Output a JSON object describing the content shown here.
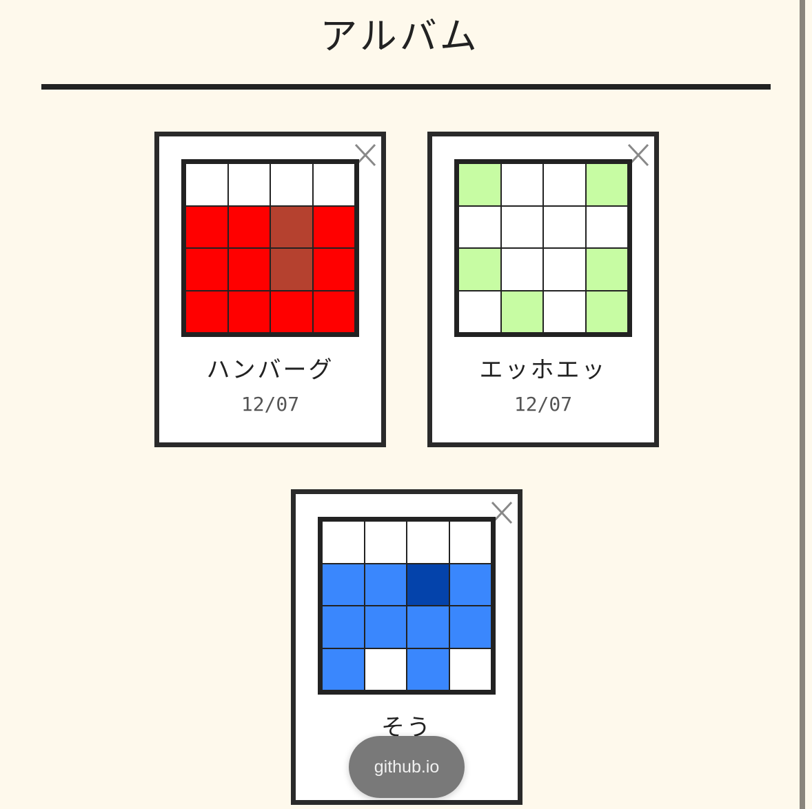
{
  "page": {
    "title": "アルバム"
  },
  "colors": {
    "background": "#fef9ec",
    "card_border": "#2a2a2a",
    "grid_border": "#222222"
  },
  "album": {
    "items": [
      {
        "name": "ハンバーグ",
        "date": "12/07",
        "close_icon": "close-icon",
        "pixels": [
          "#ffffff",
          "#ffffff",
          "#ffffff",
          "#ffffff",
          "#ff0000",
          "#ff0000",
          "#b5412f",
          "#ff0000",
          "#ff0000",
          "#ff0000",
          "#b5412f",
          "#ff0000",
          "#ff0000",
          "#ff0000",
          "#ff0000",
          "#ff0000"
        ]
      },
      {
        "name": "エッホエッ",
        "date": "12/07",
        "close_icon": "close-icon",
        "pixels": [
          "#c7fca3",
          "#ffffff",
          "#ffffff",
          "#c7fca3",
          "#ffffff",
          "#ffffff",
          "#ffffff",
          "#ffffff",
          "#c7fca3",
          "#ffffff",
          "#ffffff",
          "#c7fca3",
          "#ffffff",
          "#c7fca3",
          "#ffffff",
          "#c7fca3"
        ]
      },
      {
        "name": "そう",
        "date": "",
        "close_icon": "close-icon",
        "pixels": [
          "#ffffff",
          "#ffffff",
          "#ffffff",
          "#ffffff",
          "#3a87fd",
          "#3a87fd",
          "#0443ab",
          "#3a87fd",
          "#3a87fd",
          "#3a87fd",
          "#3a87fd",
          "#3a87fd",
          "#3a87fd",
          "#ffffff",
          "#3a87fd",
          "#ffffff"
        ]
      }
    ]
  },
  "toast": {
    "label": "github.io"
  }
}
